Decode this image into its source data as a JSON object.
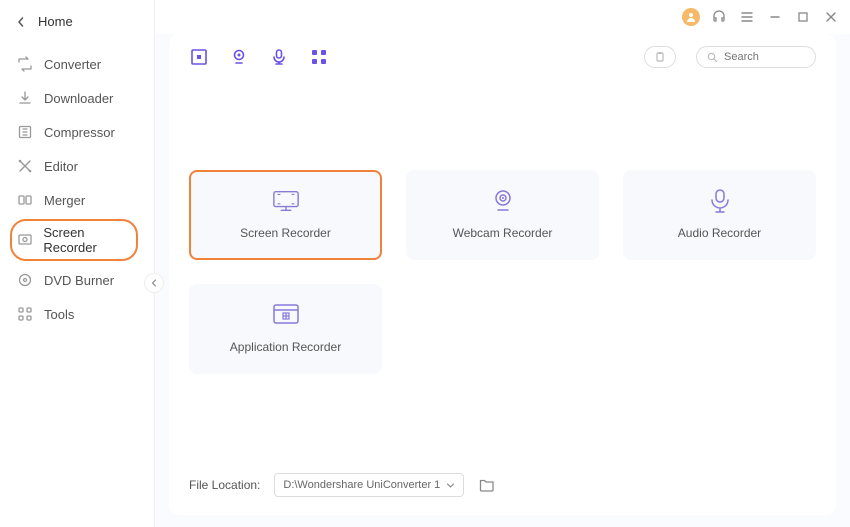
{
  "sidebar": {
    "home": "Home",
    "items": [
      {
        "label": "Converter"
      },
      {
        "label": "Downloader"
      },
      {
        "label": "Compressor"
      },
      {
        "label": "Editor"
      },
      {
        "label": "Merger"
      },
      {
        "label": "Screen Recorder"
      },
      {
        "label": "DVD Burner"
      },
      {
        "label": "Tools"
      }
    ]
  },
  "search": {
    "placeholder": "Search"
  },
  "cards": [
    {
      "label": "Screen Recorder"
    },
    {
      "label": "Webcam Recorder"
    },
    {
      "label": "Audio Recorder"
    },
    {
      "label": "Application Recorder"
    }
  ],
  "footer": {
    "file_location_label": "File Location:",
    "location_value": "D:\\Wondershare UniConverter 1"
  }
}
